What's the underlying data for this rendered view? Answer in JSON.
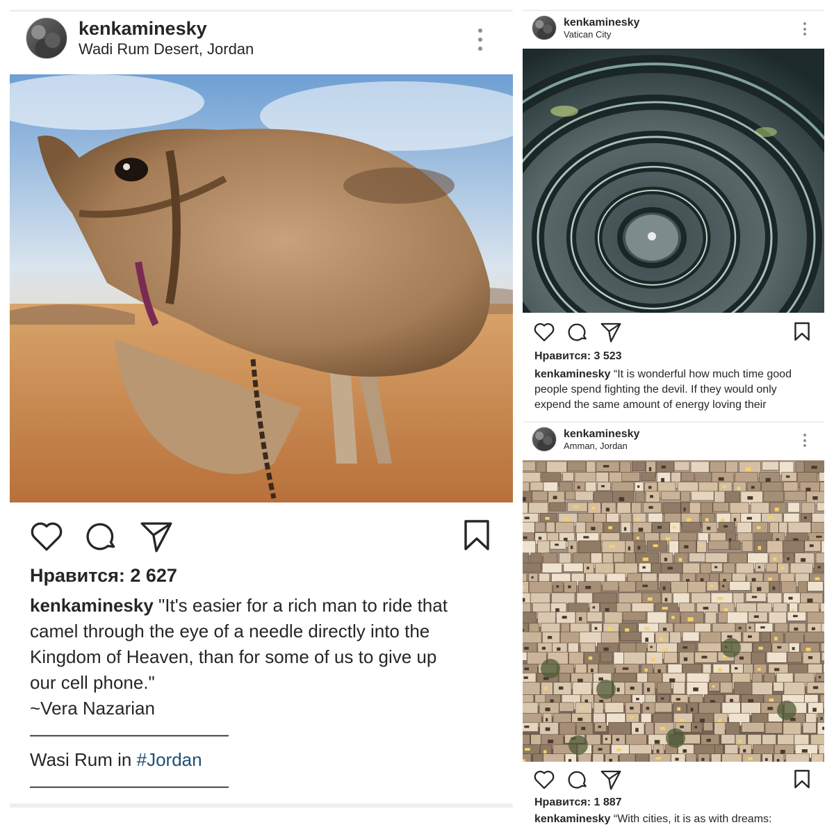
{
  "posts": [
    {
      "username": "kenkaminesky",
      "location": "Wadi Rum Desert, Jordan",
      "image": "camel-closeup-desert",
      "likes_label": "Нравится: 2 627",
      "caption_user": "kenkaminesky",
      "caption_lines": [
        "\"It's easier for a rich man to ride that",
        "camel through the eye of a needle directly into the",
        "Kingdom of Heaven, than for some of us to give up",
        "our cell phone.\"",
        "~Vera Nazarian",
        "———————————",
        "Wasi Rum in ",
        "———————————"
      ],
      "hashtag": "#Jordan"
    },
    {
      "username": "kenkaminesky",
      "location": "Vatican City",
      "image": "spiral-staircase",
      "likes_label": "Нравится: 3 523",
      "caption_user": "kenkaminesky",
      "caption_text": "“It is wonderful how much time good people spend fighting the devil. If they would only expend the same amount of energy loving their"
    },
    {
      "username": "kenkaminesky",
      "location": "Amman, Jordan",
      "image": "amman-cityscape",
      "likes_label": "Нравится: 1 887",
      "caption_user": "kenkaminesky",
      "caption_text": "“With cities, it is as with dreams:"
    }
  ],
  "icons": [
    "heart-icon",
    "comment-icon",
    "share-icon",
    "bookmark-icon",
    "more-options-icon"
  ],
  "colors": {
    "text": "#262626",
    "hashtag": "#1f4e79",
    "divider": "#efefef",
    "dots": "#8e8e8e"
  }
}
